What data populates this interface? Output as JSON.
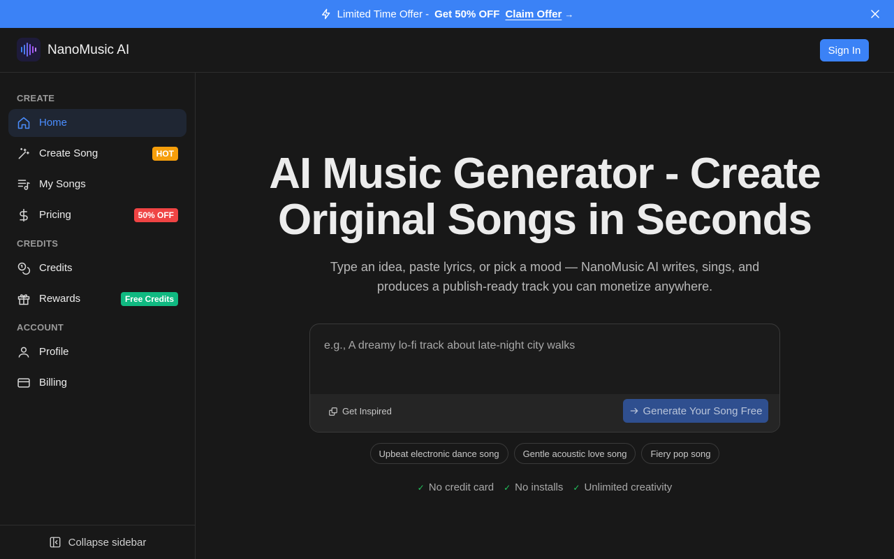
{
  "promo": {
    "icon": "lightning-bolt-icon",
    "text": "Limited Time Offer -",
    "highlight": "Get 50% OFF",
    "link": "Claim Offer",
    "arrow": "→",
    "close_icon": "close-icon"
  },
  "header": {
    "brand": "NanoMusic AI",
    "logo_icon": "audio-wave-icon",
    "sign_in": "Sign In"
  },
  "sidebar": {
    "sections": {
      "create": "CREATE",
      "credits": "CREDITS",
      "account": "ACCOUNT"
    },
    "items": [
      {
        "label": "Home",
        "icon": "home-icon",
        "active": true
      },
      {
        "label": "Create Song",
        "icon": "magic-wand-icon",
        "badge": "HOT"
      },
      {
        "label": "My Songs",
        "icon": "music-list-icon"
      },
      {
        "label": "Pricing",
        "icon": "dollar-icon",
        "badge": "50% OFF"
      },
      {
        "label": "Credits",
        "icon": "coins-icon"
      },
      {
        "label": "Rewards",
        "icon": "gift-icon",
        "badge": "Free Credits"
      },
      {
        "label": "Profile",
        "icon": "user-icon"
      },
      {
        "label": "Billing",
        "icon": "credit-card-icon"
      }
    ],
    "collapse": "Collapse sidebar"
  },
  "hero": {
    "title_line1": "AI Music Generator - Create",
    "title_line2": "Original Songs in Seconds",
    "subtitle": "Type an idea, paste lyrics, or pick a mood — NanoMusic AI writes, sings, and produces a publish-ready track you can monetize anywhere."
  },
  "prompt": {
    "placeholder": "e.g., A dreamy lo-fi track about late-night city walks",
    "value": "",
    "inspire": "Get Inspired",
    "generate": "Generate Your Song Free"
  },
  "chips": [
    "Upbeat electronic dance song",
    "Gentle acoustic love song",
    "Fiery pop song"
  ],
  "features": [
    "No credit card",
    "No installs",
    "Unlimited creativity"
  ],
  "colors": {
    "accent": "#3b82f6",
    "background": "#181818",
    "hot_badge": "#f59e0b",
    "discount_badge": "#ef4444",
    "free_badge": "#10b981"
  }
}
